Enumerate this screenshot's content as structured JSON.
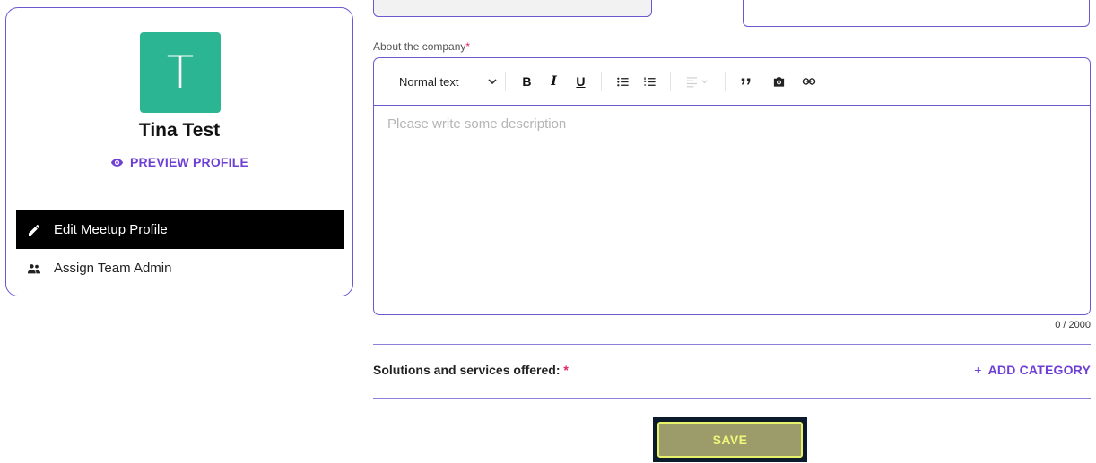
{
  "profile": {
    "avatar_letter": "T",
    "avatar_color": "#2cb592",
    "name": "Tina Test",
    "preview_label": "PREVIEW PROFILE",
    "menu": [
      {
        "label": "Edit Meetup Profile",
        "icon": "pencil-icon",
        "active": true
      },
      {
        "label": "Assign Team Admin",
        "icon": "team-icon",
        "active": false
      }
    ]
  },
  "form": {
    "about_label": "About the company",
    "required_mark": "*",
    "editor": {
      "text_style": "Normal text",
      "placeholder": "Please write some description",
      "char_count": "0 / 2000",
      "toolbar": [
        "bold-icon",
        "italic-icon",
        "underline-icon",
        "bullet-list-icon",
        "numbered-list-icon",
        "align-icon",
        "quote-icon",
        "image-icon",
        "link-icon"
      ],
      "bold_glyph": "B",
      "italic_glyph": "I",
      "underline_glyph": "U"
    },
    "solutions_label": "Solutions and services offered:",
    "add_category_label": "ADD CATEGORY",
    "add_category_plus": "+",
    "save_label": "SAVE"
  },
  "colors": {
    "accent": "#6e3fd4",
    "border": "#6e56cf",
    "required": "#e0245e",
    "save_bg": "#9c9c6a",
    "save_text": "#eff77a"
  }
}
